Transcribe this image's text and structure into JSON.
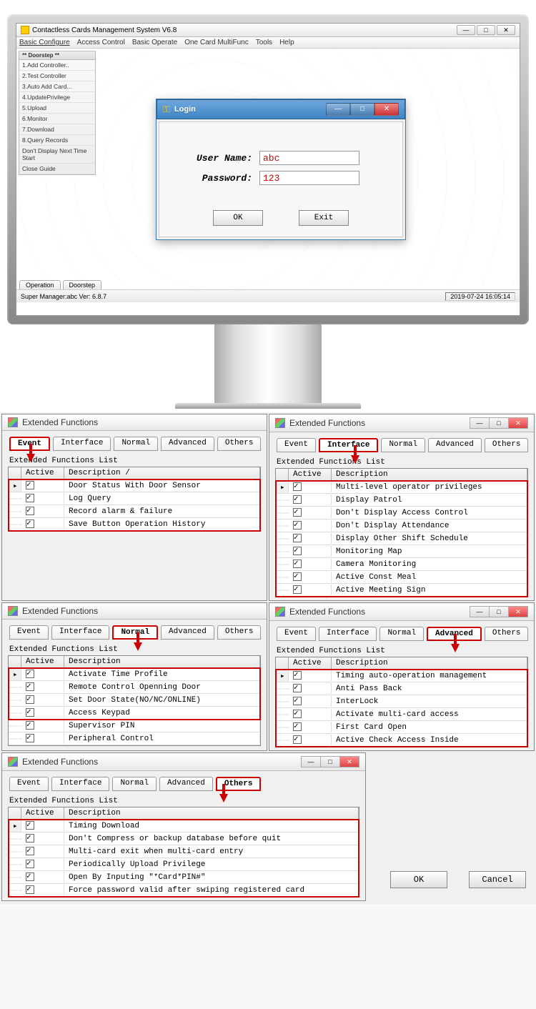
{
  "app": {
    "title": "Contactless Cards Management System  V6.8",
    "menus": [
      "Basic Configure",
      "Access Control",
      "Basic Operate",
      "One Card MultiFunc",
      "Tools",
      "Help"
    ],
    "sidebar": {
      "header": "** Doorstep **",
      "items": [
        "1.Add Controller..",
        "2.Test Controller",
        "3.Auto Add Card...",
        "4.UpdatePrivilege",
        "5.Upload",
        "6.Monitor",
        "7.Download",
        "8.Query Records",
        "Don't Display Next Time Start",
        "Close Guide"
      ]
    },
    "status_left": "Super Manager:abc    Ver: 6.8.7",
    "status_right": "2019-07-24 16:05:14",
    "bottom_tabs": [
      "Operation",
      "Doorstep"
    ]
  },
  "login": {
    "title": "Login",
    "user_label": "User Name:",
    "pass_label": "Password:",
    "user_value": "abc",
    "pass_value": "123",
    "ok": "OK",
    "exit": "Exit"
  },
  "ef": {
    "title": "Extended Functions",
    "tabs": [
      "Event",
      "Interface",
      "Normal",
      "Advanced",
      "Others"
    ],
    "list_label": "Extended Functions List",
    "cols": {
      "active": "Active",
      "desc": "Description"
    },
    "ok": "OK",
    "cancel": "Cancel"
  },
  "panels": {
    "event": [
      "Door Status With Door Sensor",
      "Log Query",
      "Record alarm & failure",
      "Save Button Operation History"
    ],
    "interface": [
      "Multi-level operator privileges",
      "Display Patrol",
      "Don't Display Access Control",
      "Don't Display Attendance",
      "Display Other Shift Schedule",
      "Monitoring Map",
      "Camera Monitoring",
      "Active Const Meal",
      "Active Meeting Sign"
    ],
    "normal": [
      "Activate Time Profile",
      "Remote Control Openning Door",
      "Set Door State(NO/NC/ONLINE)",
      "Access Keypad",
      "Supervisor PIN",
      "Peripheral Control"
    ],
    "advanced": [
      "Timing auto-operation management",
      "Anti Pass Back",
      "InterLock",
      "Activate multi-card access",
      "First Card Open",
      "Active Check Access Inside"
    ],
    "others": [
      "Timing Download",
      "Don't Compress or backup database before quit",
      "Multi-card exit when multi-card entry",
      "Periodically Upload Privilege",
      "Open By Inputing \"*Card*PIN#\"",
      "Force password valid after swiping registered card"
    ]
  }
}
